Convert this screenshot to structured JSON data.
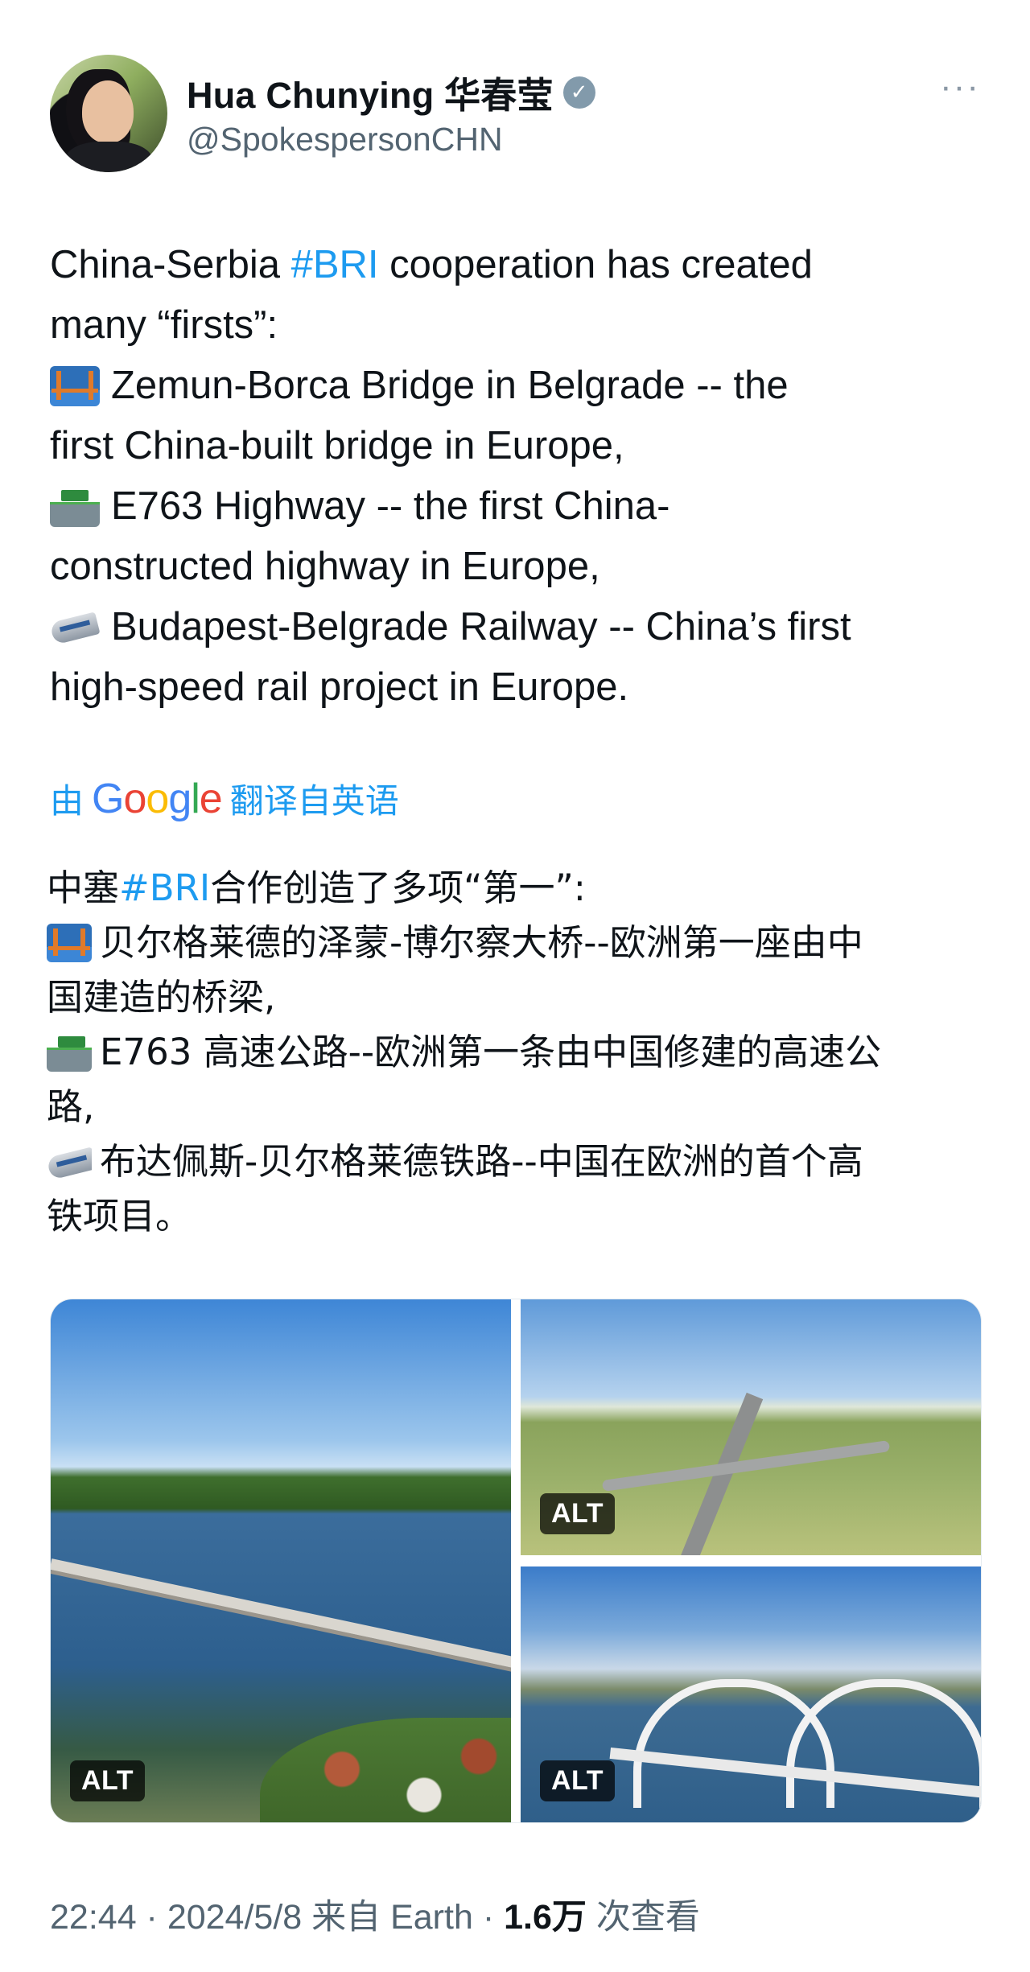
{
  "author": {
    "name": "Hua Chunying 华春莹",
    "handle": "@SpokespersonCHN"
  },
  "tweet": {
    "l1a": "China-Serbia ",
    "hashtag": "#BRI",
    "l1b": " cooperation has created",
    "l2": "many “firsts”:",
    "l3": "Zemun-Borca Bridge in Belgrade -- the",
    "l4": "first China-built bridge in Europe,",
    "l5": "E763 Highway -- the first China-",
    "l6": "constructed highway in Europe,",
    "l7": "Budapest-Belgrade Railway -- China’s first",
    "l8": "high-speed rail project in Europe."
  },
  "translation": {
    "prefix": "由",
    "google": "Google",
    "suffix": "翻译自英语"
  },
  "tweet_zh": {
    "l1a": "中塞",
    "hashtag": "#BRI",
    "l1b": "合作创造了多项“第一”:",
    "l2": "贝尔格莱德的泽蒙-博尔察大桥--欧洲第一座由中",
    "l3": "国建造的桥梁,",
    "l4": "E763 高速公路--欧洲第一条由中国修建的高速公",
    "l5": "路,",
    "l6": "布达佩斯-贝尔格莱德铁路--中国在欧洲的首个高",
    "l7": "铁项目。"
  },
  "media": {
    "alt_label": "ALT"
  },
  "meta": {
    "time": "22:44 · 2024/5/8 来自 Earth · ",
    "views": "1.6万",
    "views_suffix": " 次查看"
  },
  "icons": [
    "avatar",
    "verified-badge-icon",
    "more-icon",
    "bridge-emoji-icon",
    "highway-emoji-icon",
    "train-emoji-icon"
  ]
}
